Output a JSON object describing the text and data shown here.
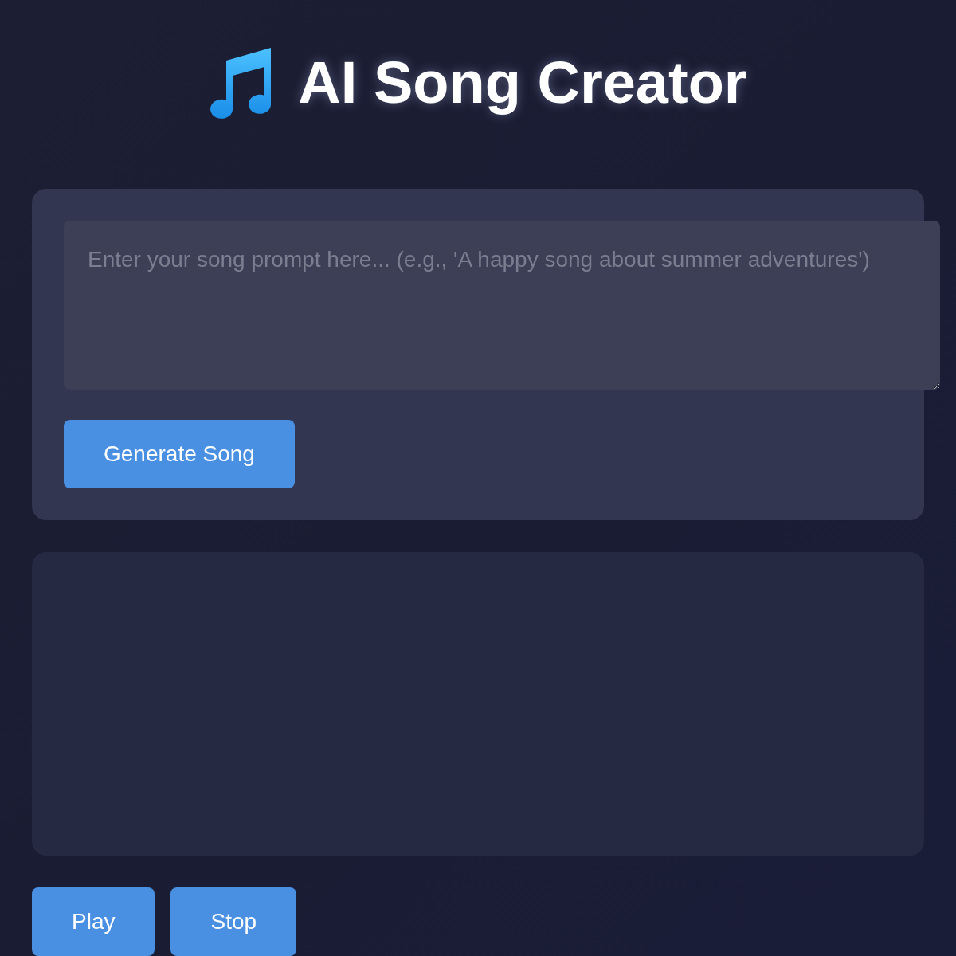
{
  "title": "AI Song Creator",
  "prompt": {
    "placeholder": "Enter your song prompt here... (e.g., 'A happy song about summer adventures')"
  },
  "generate_button": "Generate Song",
  "playback_buttons": [
    "Play",
    "Stop"
  ]
}
